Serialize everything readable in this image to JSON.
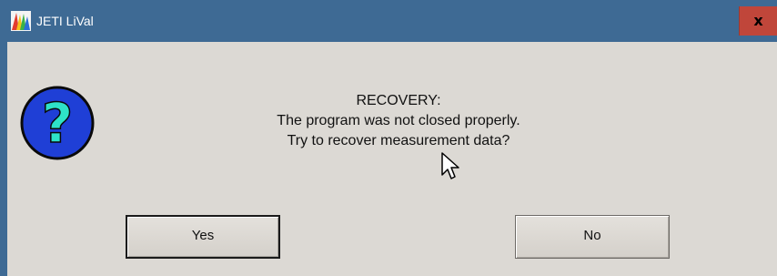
{
  "window": {
    "title": "JETI LiVal",
    "close_label": "x"
  },
  "icons": {
    "app": "jeti-livAL-app-icon",
    "dialog": "question-mark-icon",
    "close": "close-icon",
    "cursor": "mouse-pointer-icon"
  },
  "message": {
    "heading": "RECOVERY:",
    "line1": "The program was not closed properly.",
    "line2": "Try to recover measurement data?"
  },
  "buttons": {
    "yes": "Yes",
    "no": "No"
  },
  "colors": {
    "titlebar": "#3e6a94",
    "close": "#c0463a",
    "dialog_bg": "#dcd9d4",
    "question_circle": "#1f3fd6",
    "question_mark": "#2ee2c8"
  }
}
